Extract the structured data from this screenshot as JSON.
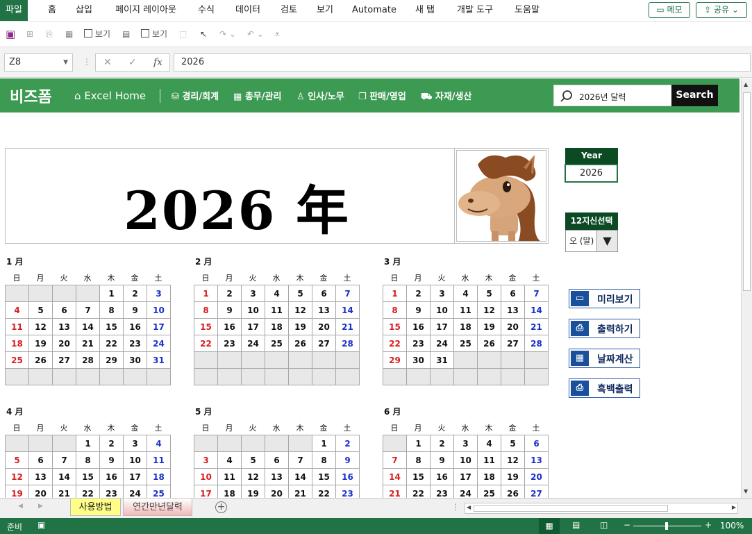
{
  "ribbon": {
    "tabs": [
      "파일",
      "홈",
      "삽입",
      "페이지 레이아웃",
      "수식",
      "데이터",
      "검토",
      "보기",
      "Automate",
      "새 탭",
      "개발 도구",
      "도움말"
    ],
    "memo": "메모",
    "share": "공유"
  },
  "qat": {
    "check1_label": "보기",
    "check2_label": "보기"
  },
  "formula_bar": {
    "name_box": "Z8",
    "cancel": "✕",
    "enter": "✓",
    "fx": "fx",
    "value": "2026"
  },
  "banner": {
    "logo": "비즈폼",
    "home": "Excel Home",
    "nav": [
      "경리/회계",
      "총무/관리",
      "인사/노무",
      "판매/영업",
      "자재/생산"
    ],
    "search_value": "2026년 달력",
    "search_button": "Search"
  },
  "calendar": {
    "title": "2026 年",
    "year_label": "Year",
    "year_value": "2026",
    "zodiac_label": "12지신선택",
    "zodiac_value": "오 (말)",
    "buttons": [
      "미리보기",
      "출력하기",
      "날짜계산",
      "흑백출력"
    ],
    "weekdays": [
      "日",
      "月",
      "火",
      "水",
      "木",
      "金",
      "土"
    ],
    "months": [
      {
        "title": "1 月",
        "rows": [
          [
            "",
            "",
            "",
            "",
            "1",
            "2",
            "3"
          ],
          [
            "4",
            "5",
            "6",
            "7",
            "8",
            "9",
            "10"
          ],
          [
            "11",
            "12",
            "13",
            "14",
            "15",
            "16",
            "17"
          ],
          [
            "18",
            "19",
            "20",
            "21",
            "22",
            "23",
            "24"
          ],
          [
            "25",
            "26",
            "27",
            "28",
            "29",
            "30",
            "31"
          ],
          [
            "",
            "",
            "",
            "",
            "",
            "",
            ""
          ]
        ]
      },
      {
        "title": "2 月",
        "rows": [
          [
            "1",
            "2",
            "3",
            "4",
            "5",
            "6",
            "7"
          ],
          [
            "8",
            "9",
            "10",
            "11",
            "12",
            "13",
            "14"
          ],
          [
            "15",
            "16",
            "17",
            "18",
            "19",
            "20",
            "21"
          ],
          [
            "22",
            "23",
            "24",
            "25",
            "26",
            "27",
            "28"
          ],
          [
            "",
            "",
            "",
            "",
            "",
            "",
            ""
          ],
          [
            "",
            "",
            "",
            "",
            "",
            "",
            ""
          ]
        ]
      },
      {
        "title": "3 月",
        "rows": [
          [
            "1",
            "2",
            "3",
            "4",
            "5",
            "6",
            "7"
          ],
          [
            "8",
            "9",
            "10",
            "11",
            "12",
            "13",
            "14"
          ],
          [
            "15",
            "16",
            "17",
            "18",
            "19",
            "20",
            "21"
          ],
          [
            "22",
            "23",
            "24",
            "25",
            "26",
            "27",
            "28"
          ],
          [
            "29",
            "30",
            "31",
            "",
            "",
            "",
            ""
          ],
          [
            "",
            "",
            "",
            "",
            "",
            "",
            ""
          ]
        ]
      },
      {
        "title": "4 月",
        "rows": [
          [
            "",
            "",
            "",
            "1",
            "2",
            "3",
            "4"
          ],
          [
            "5",
            "6",
            "7",
            "8",
            "9",
            "10",
            "11"
          ],
          [
            "12",
            "13",
            "14",
            "15",
            "16",
            "17",
            "18"
          ],
          [
            "19",
            "20",
            "21",
            "22",
            "23",
            "24",
            "25"
          ]
        ]
      },
      {
        "title": "5 月",
        "rows": [
          [
            "",
            "",
            "",
            "",
            "",
            "1",
            "2"
          ],
          [
            "3",
            "4",
            "5",
            "6",
            "7",
            "8",
            "9"
          ],
          [
            "10",
            "11",
            "12",
            "13",
            "14",
            "15",
            "16"
          ],
          [
            "17",
            "18",
            "19",
            "20",
            "21",
            "22",
            "23"
          ]
        ]
      },
      {
        "title": "6 月",
        "rows": [
          [
            "",
            "1",
            "2",
            "3",
            "4",
            "5",
            "6"
          ],
          [
            "7",
            "8",
            "9",
            "10",
            "11",
            "12",
            "13"
          ],
          [
            "14",
            "15",
            "16",
            "17",
            "18",
            "19",
            "20"
          ],
          [
            "21",
            "22",
            "23",
            "24",
            "25",
            "26",
            "27"
          ]
        ]
      }
    ]
  },
  "sheet_tabs": [
    "사용방법",
    "연간만년달력"
  ],
  "status": {
    "ready": "준비",
    "zoom": "100%"
  },
  "colors": {
    "excel_green": "#217346",
    "banner_green": "#3c9a52",
    "sunday": "#d81e1e",
    "saturday": "#1a31c8",
    "dark_green": "#0c4a23"
  }
}
